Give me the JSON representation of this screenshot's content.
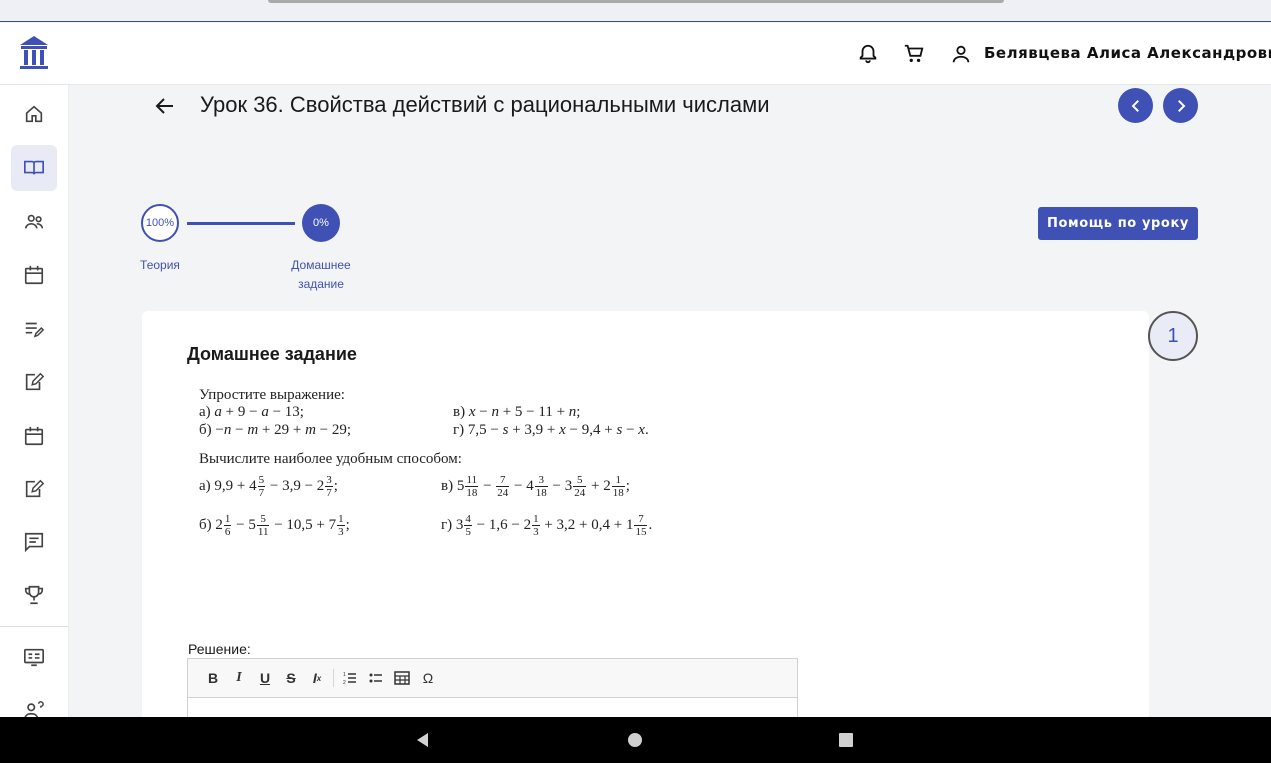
{
  "header": {
    "user_name": "Белявцева Алиса Александровна",
    "icons": [
      "logo-icon",
      "bell-icon",
      "cart-icon",
      "user-icon"
    ]
  },
  "sidebar": {
    "items": [
      "home-icon",
      "lessons-icon",
      "people-icon",
      "calendar-icon",
      "tasks-icon",
      "edit-icon",
      "calendar-icon",
      "edit-icon",
      "chat-icon",
      "trophy-icon",
      "board-icon",
      "help-icon"
    ]
  },
  "lesson": {
    "title": "Урок 36. Свойства действий с рациональными числами"
  },
  "stepper": {
    "steps": [
      {
        "percent": "100%",
        "label": "Теория"
      },
      {
        "percent": "0%",
        "label": "Домашнее задание"
      }
    ]
  },
  "help_button": "Помощь по уроку",
  "task": {
    "number": "1",
    "title": "Домашнее задание",
    "simplify_heading": "Упростите выражение:",
    "calc_heading": "Вычислите наиболее удобным способом:"
  },
  "solution": {
    "label": "Решение:"
  },
  "colors": {
    "accent": "#3f51b5",
    "background": "#f3f4f6"
  }
}
